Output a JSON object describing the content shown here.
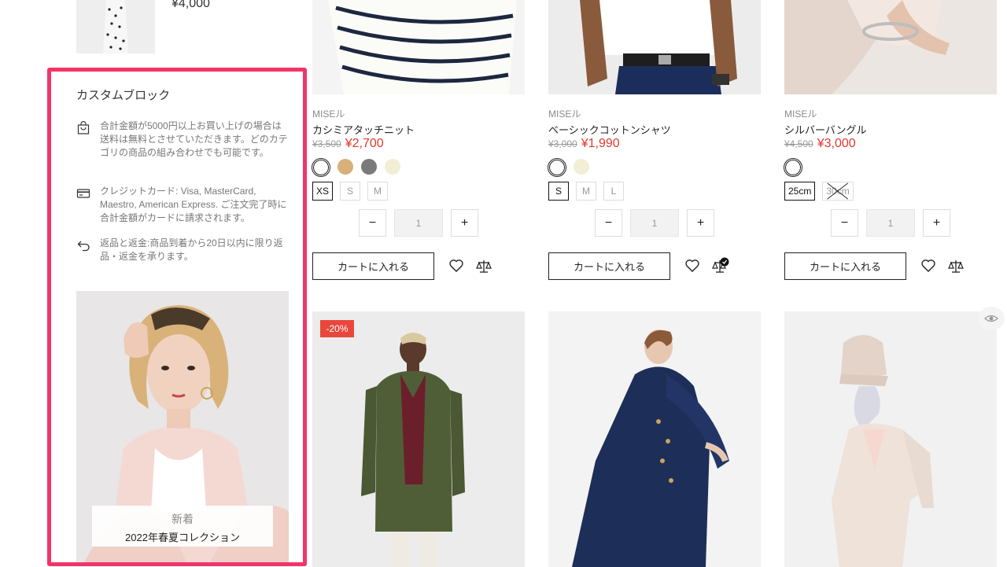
{
  "sidebar": {
    "prev_product_price": "¥4,000",
    "custom_block": {
      "title": "カスタムブロック",
      "rows": [
        {
          "icon": "shopping-bag-icon",
          "text": "合計金額が5000円以上お買い上げの場合は送料は無料とさせていただきます。どのカテゴリの商品の組み合わせでも可能です。"
        },
        {
          "icon": "credit-card-icon",
          "text": "クレジットカード: Visa, MasterCard, Maestro, American Express. ご注文完了時に合計金額がカードに請求されます。"
        },
        {
          "icon": "return-arrow-icon",
          "text": "返品と返金:商品到着から20日以内に限り返品・返金を承ります。"
        }
      ]
    },
    "banner": {
      "line1": "新着",
      "line2": "2022年春夏コレクション"
    }
  },
  "products": [
    {
      "brand": "MISEル",
      "name": "カシミアタッチニット",
      "old_price": "¥3,500",
      "price": "¥2,700",
      "colors": [
        "#ffffff",
        "#d8b07a",
        "#7a7a7a",
        "#f2eed6"
      ],
      "sizes": [
        "XS",
        "S",
        "M"
      ],
      "selected_size": "XS",
      "quantity": "1",
      "cart_label": "カートに入れる"
    },
    {
      "brand": "MISEル",
      "name": "ベーシックコットンシャツ",
      "old_price": "¥3,000",
      "price": "¥1,990",
      "colors": [
        "#ffffff",
        "#f2eed6"
      ],
      "sizes": [
        "S",
        "M",
        "L"
      ],
      "selected_size": "S",
      "quantity": "1",
      "cart_label": "カートに入れる"
    },
    {
      "brand": "MISEル",
      "name": "シルバーバングル",
      "old_price": "¥4,500",
      "price": "¥3,000",
      "colors": [
        "#ffffff"
      ],
      "sizes": [
        "25cm",
        "30cm"
      ],
      "selected_size": "25cm",
      "unavailable_size": "30cm",
      "quantity": "1",
      "cart_label": "カートに入れる"
    }
  ],
  "second_row": {
    "discount_badge": "-20%"
  },
  "qty_minus": "−",
  "qty_plus": "+",
  "colors": {
    "accent_border": "#f0356a",
    "sale_price": "#e0392f",
    "badge": "#e9473c"
  }
}
